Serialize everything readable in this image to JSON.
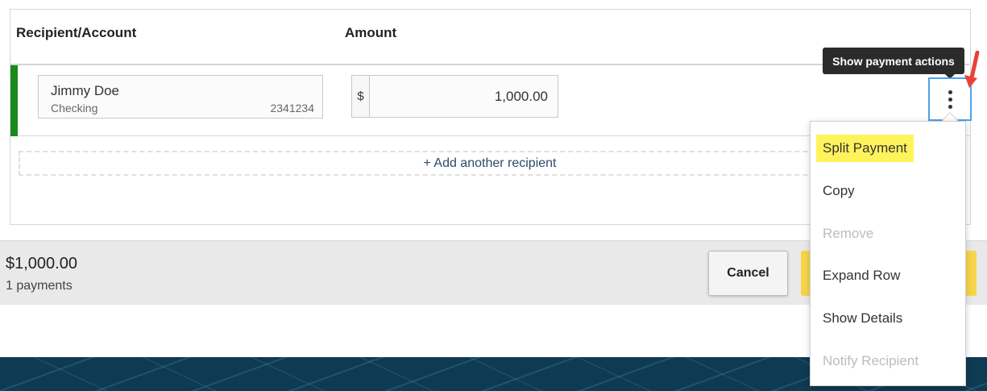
{
  "columns": {
    "recipient": "Recipient/Account",
    "amount": "Amount"
  },
  "payment_row": {
    "recipient_name": "Jimmy Doe",
    "account_type": "Checking",
    "account_number": "2341234",
    "currency_symbol": "$",
    "amount": "1,000.00"
  },
  "add_recipient_label": "+ Add another recipient",
  "footer": {
    "total_amount": "$1,000.00",
    "payment_count": "1 payments",
    "cancel_label": "Cancel",
    "primary_label": ""
  },
  "tooltip": "Show payment actions",
  "actions_menu": {
    "items": [
      {
        "label": "Split Payment",
        "state": "highlighted"
      },
      {
        "label": "Copy",
        "state": "enabled"
      },
      {
        "label": "Remove",
        "state": "disabled"
      },
      {
        "label": "Expand Row",
        "state": "enabled"
      },
      {
        "label": "Show Details",
        "state": "enabled"
      },
      {
        "label": "Notify Recipient",
        "state": "disabled"
      }
    ]
  },
  "colors": {
    "row_accent": "#1a8a1a",
    "highlight": "#fff35c",
    "primary_button": "#f7d54a",
    "focus_outline": "#4aa3ef",
    "annotation_arrow": "#e8413a"
  },
  "icons": {
    "actions_button": "kebab-vertical-icon",
    "annotation": "red-arrow-icon"
  }
}
